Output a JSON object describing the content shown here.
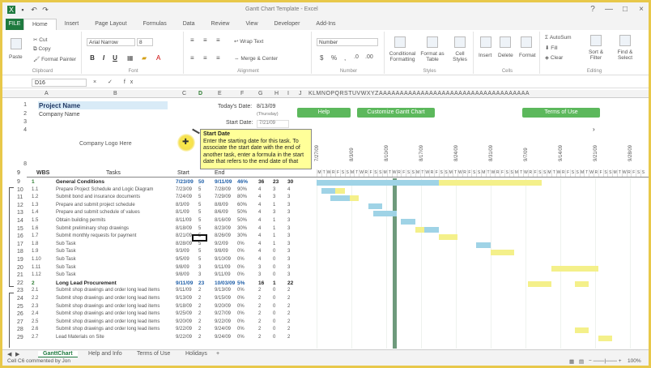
{
  "window": {
    "title": "Gantt Chart Template - Excel",
    "qat": [
      "save-icon",
      "undo-icon",
      "redo-icon"
    ],
    "controls": [
      "?",
      "—",
      "□",
      "×"
    ]
  },
  "tabs": [
    "FILE",
    "Home",
    "Insert",
    "Page Layout",
    "Formulas",
    "Data",
    "Review",
    "View",
    "Developer",
    "Add-Ins"
  ],
  "ribbon": {
    "clipboard": {
      "cut": "Cut",
      "copy": "Copy",
      "painter": "Format Painter",
      "paste": "Paste",
      "label": "Clipboard"
    },
    "font": {
      "name": "Arial Narrow",
      "size": "8",
      "bold": "B",
      "italic": "I",
      "underline": "U",
      "label": "Font"
    },
    "alignment": {
      "wrap": "Wrap Text",
      "merge": "Merge & Center",
      "label": "Alignment"
    },
    "number": {
      "format": "Number",
      "label": "Number"
    },
    "styles": {
      "cond": "Conditional Formatting",
      "table": "Format as Table",
      "cell": "Cell Styles",
      "label": "Styles"
    },
    "cells": {
      "insert": "Insert",
      "delete": "Delete",
      "format": "Format",
      "label": "Cells"
    },
    "editing": {
      "autosum": "AutoSum",
      "fill": "Fill",
      "clear": "Clear",
      "sort": "Sort & Filter",
      "find": "Find & Select",
      "label": "Editing"
    }
  },
  "formula_bar": {
    "name_box": "D16",
    "fx": "fx"
  },
  "columns": [
    "A",
    "B",
    "C",
    "D",
    "E",
    "F",
    "G",
    "H",
    "I",
    "J",
    "KLMNOPQRSTUVWXYZAAAAAAAAAAAAAAAAAAAAAAAAAAAAAAAAAAAA"
  ],
  "levels": [
    "1",
    "2"
  ],
  "project": {
    "title": "Project Name",
    "company": "Company Name",
    "logo": "Company Logo Here",
    "today_label": "Today's Date:",
    "today_val": "8/13/09",
    "today_dow": "(Thursday)",
    "start_label": "Start Date:",
    "start_val": "7/21/09"
  },
  "buttons": {
    "help": "Help",
    "customize": "Customize Gantt Chart",
    "terms": "Terms of Use"
  },
  "tooltip": {
    "heading": "Start Date",
    "body": "Enter the starting date for this task. To associate the start date with the end of another task, enter a formula in the start date that refers to the end date of that"
  },
  "week_dates": [
    "7/27/09",
    "8/3/09",
    "8/10/09",
    "8/17/09",
    "8/24/09",
    "8/31/09",
    "9/7/09",
    "9/14/09",
    "9/21/09",
    "9/28/09"
  ],
  "grid_header": {
    "wbs": "WBS",
    "tasks": "Tasks",
    "start": "Start",
    "end": "End"
  },
  "day_letters": [
    "M",
    "T",
    "W",
    "R",
    "F",
    "S",
    "S",
    "M",
    "T",
    "W",
    "R",
    "F",
    "S",
    "S",
    "M",
    "T",
    "W",
    "R",
    "F",
    "S",
    "S",
    "M",
    "T",
    "W",
    "R",
    "F",
    "S",
    "S",
    "M",
    "T",
    "W",
    "R",
    "F",
    "S",
    "S",
    "M",
    "T",
    "W",
    "R",
    "F",
    "S",
    "S",
    "M",
    "T",
    "W",
    "R",
    "F",
    "S",
    "S",
    "M",
    "T",
    "W",
    "R",
    "F",
    "S",
    "S",
    "M",
    "T",
    "W",
    "R",
    "F",
    "S",
    "S",
    "M",
    "T",
    "W",
    "R",
    "F",
    "S",
    "S"
  ],
  "tasks": [
    {
      "row": "9",
      "wbs": "1",
      "name": "General Conditions",
      "start": "7/23/09",
      "days": "50",
      "end": "9/11/09",
      "pct": "46%",
      "a": "36",
      "b": "23",
      "c": "30",
      "group": true
    },
    {
      "row": "10",
      "wbs": "1.1",
      "name": "Prepare Project Schedule and Logic Diagram",
      "start": "7/23/09",
      "days": "5",
      "end": "7/28/09",
      "pct": "90%",
      "a": "4",
      "b": "3",
      "c": "4",
      "group": false
    },
    {
      "row": "11",
      "wbs": "1.2",
      "name": "Submit bond and insurance documents",
      "start": "7/24/09",
      "days": "5",
      "end": "7/29/09",
      "pct": "80%",
      "a": "4",
      "b": "3",
      "c": "3",
      "group": false
    },
    {
      "row": "12",
      "wbs": "1.3",
      "name": "Prepare and submit project schedule",
      "start": "8/3/09",
      "days": "5",
      "end": "8/8/09",
      "pct": "60%",
      "a": "4",
      "b": "1",
      "c": "3",
      "group": false
    },
    {
      "row": "13",
      "wbs": "1.4",
      "name": "Prepare and submit schedule of values",
      "start": "8/1/09",
      "days": "5",
      "end": "8/6/09",
      "pct": "50%",
      "a": "4",
      "b": "3",
      "c": "3",
      "group": false
    },
    {
      "row": "14",
      "wbs": "1.5",
      "name": "Obtain building permits",
      "start": "8/11/09",
      "days": "5",
      "end": "8/16/09",
      "pct": "50%",
      "a": "4",
      "b": "1",
      "c": "3",
      "group": false
    },
    {
      "row": "15",
      "wbs": "1.6",
      "name": "Submit preliminary shop drawings",
      "start": "8/18/09",
      "days": "5",
      "end": "8/23/09",
      "pct": "30%",
      "a": "4",
      "b": "1",
      "c": "3",
      "group": false
    },
    {
      "row": "16",
      "wbs": "1.7",
      "name": "Submit monthly requests for payment",
      "start": "8/21/09",
      "days": "5",
      "end": "8/26/09",
      "pct": "30%",
      "a": "4",
      "b": "1",
      "c": "3",
      "group": false
    },
    {
      "row": "17",
      "wbs": "1.8",
      "name": "Sub Task",
      "start": "8/28/09",
      "days": "5",
      "end": "9/2/09",
      "pct": "0%",
      "a": "4",
      "b": "1",
      "c": "3",
      "group": false
    },
    {
      "row": "18",
      "wbs": "1.9",
      "name": "Sub Task",
      "start": "9/3/09",
      "days": "5",
      "end": "9/8/09",
      "pct": "0%",
      "a": "4",
      "b": "0",
      "c": "3",
      "group": false
    },
    {
      "row": "19",
      "wbs": "1.10",
      "name": "Sub Task",
      "start": "9/5/09",
      "days": "5",
      "end": "9/10/09",
      "pct": "0%",
      "a": "4",
      "b": "0",
      "c": "3",
      "group": false
    },
    {
      "row": "20",
      "wbs": "1.11",
      "name": "Sub Task",
      "start": "9/8/09",
      "days": "3",
      "end": "9/11/09",
      "pct": "0%",
      "a": "3",
      "b": "0",
      "c": "3",
      "group": false
    },
    {
      "row": "21",
      "wbs": "1.12",
      "name": "Sub Task",
      "start": "9/8/09",
      "days": "3",
      "end": "9/11/09",
      "pct": "0%",
      "a": "3",
      "b": "0",
      "c": "3",
      "group": false
    },
    {
      "row": "22",
      "wbs": "2",
      "name": "Long Lead Procurement",
      "start": "9/11/09",
      "days": "23",
      "end": "10/03/09",
      "pct": "5%",
      "a": "16",
      "b": "1",
      "c": "22",
      "group": true
    },
    {
      "row": "23",
      "wbs": "2.1",
      "name": "Submit shop drawings and order long lead items",
      "start": "9/11/09",
      "days": "2",
      "end": "9/13/09",
      "pct": "0%",
      "a": "2",
      "b": "0",
      "c": "2",
      "group": false
    },
    {
      "row": "24",
      "wbs": "2.2",
      "name": "Submit shop drawings and order long lead items",
      "start": "9/13/09",
      "days": "2",
      "end": "9/15/09",
      "pct": "0%",
      "a": "2",
      "b": "0",
      "c": "2",
      "group": false
    },
    {
      "row": "25",
      "wbs": "2.3",
      "name": "Submit shop drawings and order long lead items",
      "start": "9/18/09",
      "days": "2",
      "end": "9/20/09",
      "pct": "0%",
      "a": "2",
      "b": "0",
      "c": "2",
      "group": false
    },
    {
      "row": "26",
      "wbs": "2.4",
      "name": "Submit shop drawings and order long lead items",
      "start": "9/25/09",
      "days": "2",
      "end": "9/27/09",
      "pct": "0%",
      "a": "2",
      "b": "0",
      "c": "2",
      "group": false
    },
    {
      "row": "27",
      "wbs": "2.5",
      "name": "Submit shop drawings and order long lead items",
      "start": "9/20/09",
      "days": "2",
      "end": "9/22/09",
      "pct": "0%",
      "a": "2",
      "b": "0",
      "c": "2",
      "group": false
    },
    {
      "row": "28",
      "wbs": "2.6",
      "name": "Submit shop drawings and order long lead items",
      "start": "9/22/09",
      "days": "2",
      "end": "9/24/09",
      "pct": "0%",
      "a": "2",
      "b": "0",
      "c": "2",
      "group": false
    },
    {
      "row": "29",
      "wbs": "2.7",
      "name": "Lead Materials on Site",
      "start": "9/22/09",
      "days": "2",
      "end": "9/24/09",
      "pct": "0%",
      "a": "2",
      "b": "0",
      "c": "2",
      "group": false
    }
  ],
  "gantt": {
    "colors": {
      "done": "#9fd3e6",
      "remaining": "#f4f08a",
      "summary": "#f2e840",
      "today": "#6e9a7c"
    },
    "bars": [
      {
        "start": 0,
        "len": 26,
        "kind": "done"
      },
      {
        "start": 26,
        "len": 22,
        "kind": "remaining"
      },
      {
        "start": 1,
        "len": 3,
        "kind": "done"
      },
      {
        "start": 4,
        "len": 2,
        "kind": "remaining"
      },
      {
        "start": 3,
        "len": 4,
        "kind": "done"
      },
      {
        "start": 7,
        "len": 2,
        "kind": "remaining"
      },
      {
        "start": 11,
        "len": 3,
        "kind": "done"
      },
      {
        "start": 14,
        "len": 2,
        "kind": "remaining"
      },
      {
        "start": 12,
        "len": 5,
        "kind": "done"
      },
      {
        "start": 18,
        "len": 3,
        "kind": "done"
      },
      {
        "start": 21,
        "len": 4,
        "kind": "remaining"
      },
      {
        "start": 23,
        "len": 3,
        "kind": "done"
      },
      {
        "start": 26,
        "len": 4,
        "kind": "remaining"
      },
      {
        "start": 34,
        "len": 3,
        "kind": "done"
      },
      {
        "start": 37,
        "len": 5,
        "kind": "remaining"
      },
      {
        "start": 45,
        "len": 5,
        "kind": "remaining"
      },
      {
        "start": 50,
        "len": 5,
        "kind": "remaining"
      },
      {
        "start": 55,
        "len": 5,
        "kind": "remaining"
      },
      {
        "start": 55,
        "len": 3,
        "kind": "remaining"
      },
      {
        "start": 55,
        "len": 3,
        "kind": "remaining"
      },
      {
        "start": 60,
        "len": 3,
        "kind": "remaining"
      }
    ]
  },
  "sheets": {
    "active": "GanttChart",
    "others": [
      "Help and Info",
      "Terms of Use",
      "Holidays"
    ],
    "add": "+"
  },
  "status": {
    "left": "Cell C6 commented by Jon",
    "zoom": "100%"
  }
}
